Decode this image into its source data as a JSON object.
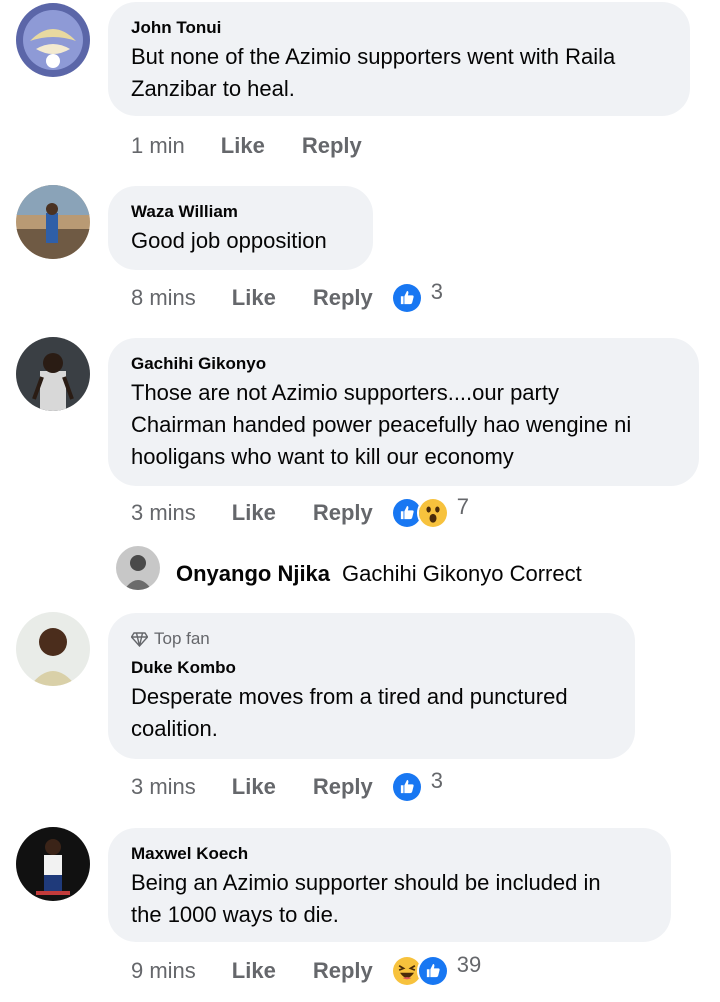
{
  "comments": [
    {
      "author": "John Tonui",
      "text_lines": [
        "But none of the Azimio supporters went with Raila",
        "Zanzibar to heal."
      ],
      "time": "1 min",
      "like": "Like",
      "reply": "Reply",
      "reactions": "",
      "badge": ""
    },
    {
      "author": "Waza William",
      "text_lines": [
        "Good job opposition"
      ],
      "time": "8 mins",
      "like": "Like",
      "reply": "Reply",
      "reactions": "3",
      "badge": ""
    },
    {
      "author": "Gachihi Gikonyo",
      "text_lines": [
        "Those are not Azimio supporters....our party",
        "Chairman handed power peacefully hao wengine ni",
        "hooligans who want to kill our economy"
      ],
      "time": "3 mins",
      "like": "Like",
      "reply": "Reply",
      "reactions": "7",
      "badge": ""
    },
    {
      "author": "Duke Kombo",
      "text_lines": [
        "Desperate moves from a tired and punctured",
        "coalition."
      ],
      "time": "3 mins",
      "like": "Like",
      "reply": "Reply",
      "reactions": "3",
      "badge": "Top fan"
    },
    {
      "author": "Maxwel Koech",
      "text_lines": [
        "Being an Azimio supporter should be included in",
        "the 1000 ways to die."
      ],
      "time": "9 mins",
      "like": "Like",
      "reply": "Reply",
      "reactions": "39",
      "badge": ""
    }
  ],
  "reply_preview": {
    "author": "Onyango Njika",
    "text": "Gachihi Gikonyo Correct"
  },
  "colors": {
    "bubble": "#f0f2f5",
    "muted": "#65676b",
    "like_blue": "#1877f2",
    "haha_yellow": "#f7c23d"
  },
  "icons": {
    "like": "thumbs-up-icon",
    "wow": "wow-icon",
    "haha": "haha-icon",
    "top_fan": "diamond-icon"
  }
}
